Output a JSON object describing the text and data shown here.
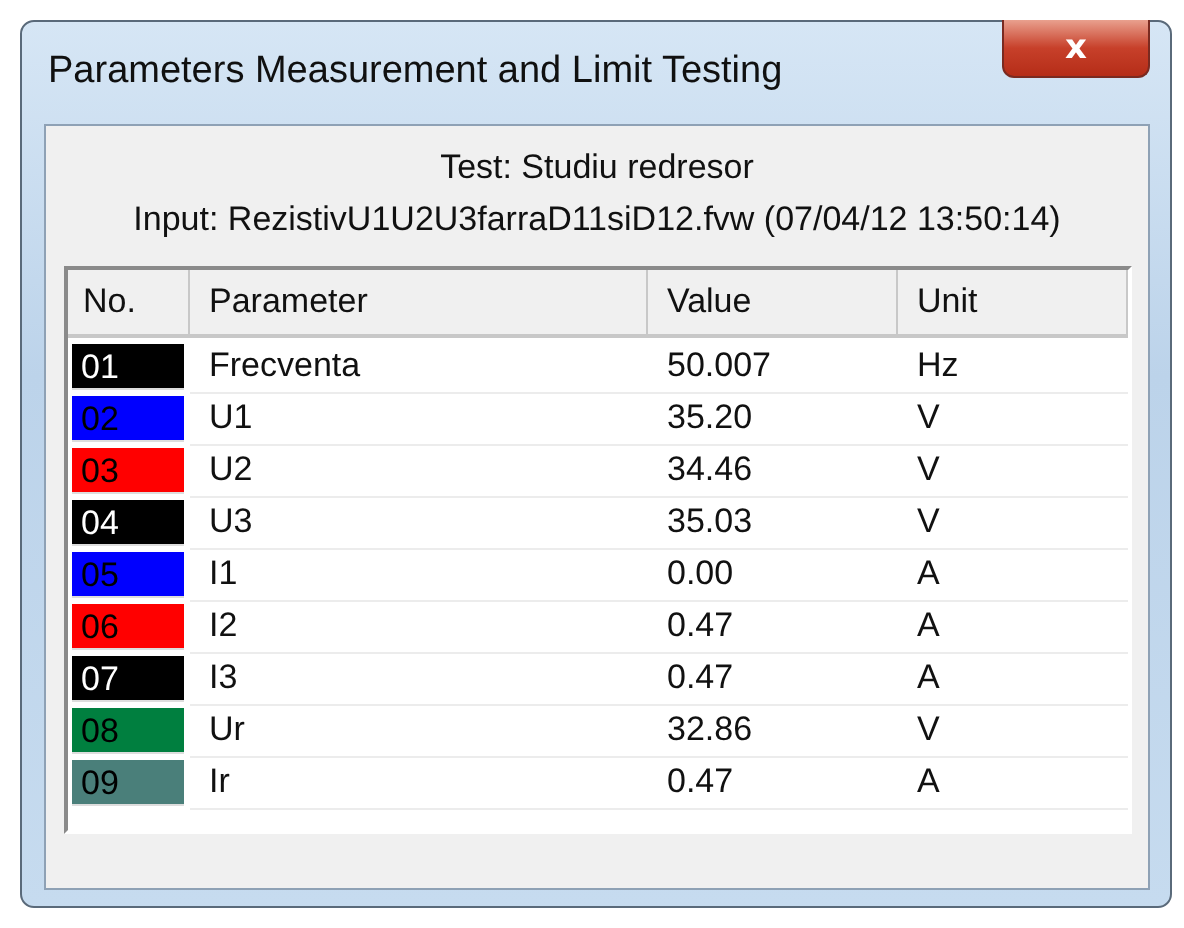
{
  "window": {
    "title": "Parameters Measurement and Limit Testing",
    "close_icon": "x"
  },
  "test": "Test: Studiu redresor",
  "input": "Input: RezistivU1U2U3farraD11siD12.fvw (07/04/12 13:50:14)",
  "table": {
    "columns": [
      "No.",
      "Parameter",
      "Value",
      "Unit"
    ],
    "rows": [
      {
        "no": "01",
        "color": "#000000",
        "parameter": "Frecventa",
        "value": "50.007",
        "unit": "Hz"
      },
      {
        "no": "02",
        "color": "#0000ff",
        "parameter": "U1",
        "value": "35.20",
        "unit": "V"
      },
      {
        "no": "03",
        "color": "#ff0000",
        "parameter": "U2",
        "value": "34.46",
        "unit": "V"
      },
      {
        "no": "04",
        "color": "#000000",
        "parameter": "U3",
        "value": "35.03",
        "unit": "V"
      },
      {
        "no": "05",
        "color": "#0000ff",
        "parameter": "I1",
        "value": "0.00",
        "unit": "A"
      },
      {
        "no": "06",
        "color": "#ff0000",
        "parameter": "I2",
        "value": "0.47",
        "unit": "A"
      },
      {
        "no": "07",
        "color": "#000000",
        "parameter": "I3",
        "value": "0.47",
        "unit": "A"
      },
      {
        "no": "08",
        "color": "#007f3f",
        "parameter": "Ur",
        "value": "32.86",
        "unit": "V"
      },
      {
        "no": "09",
        "color": "#4a7f7a",
        "parameter": "Ir",
        "value": "0.47",
        "unit": "A"
      }
    ]
  }
}
